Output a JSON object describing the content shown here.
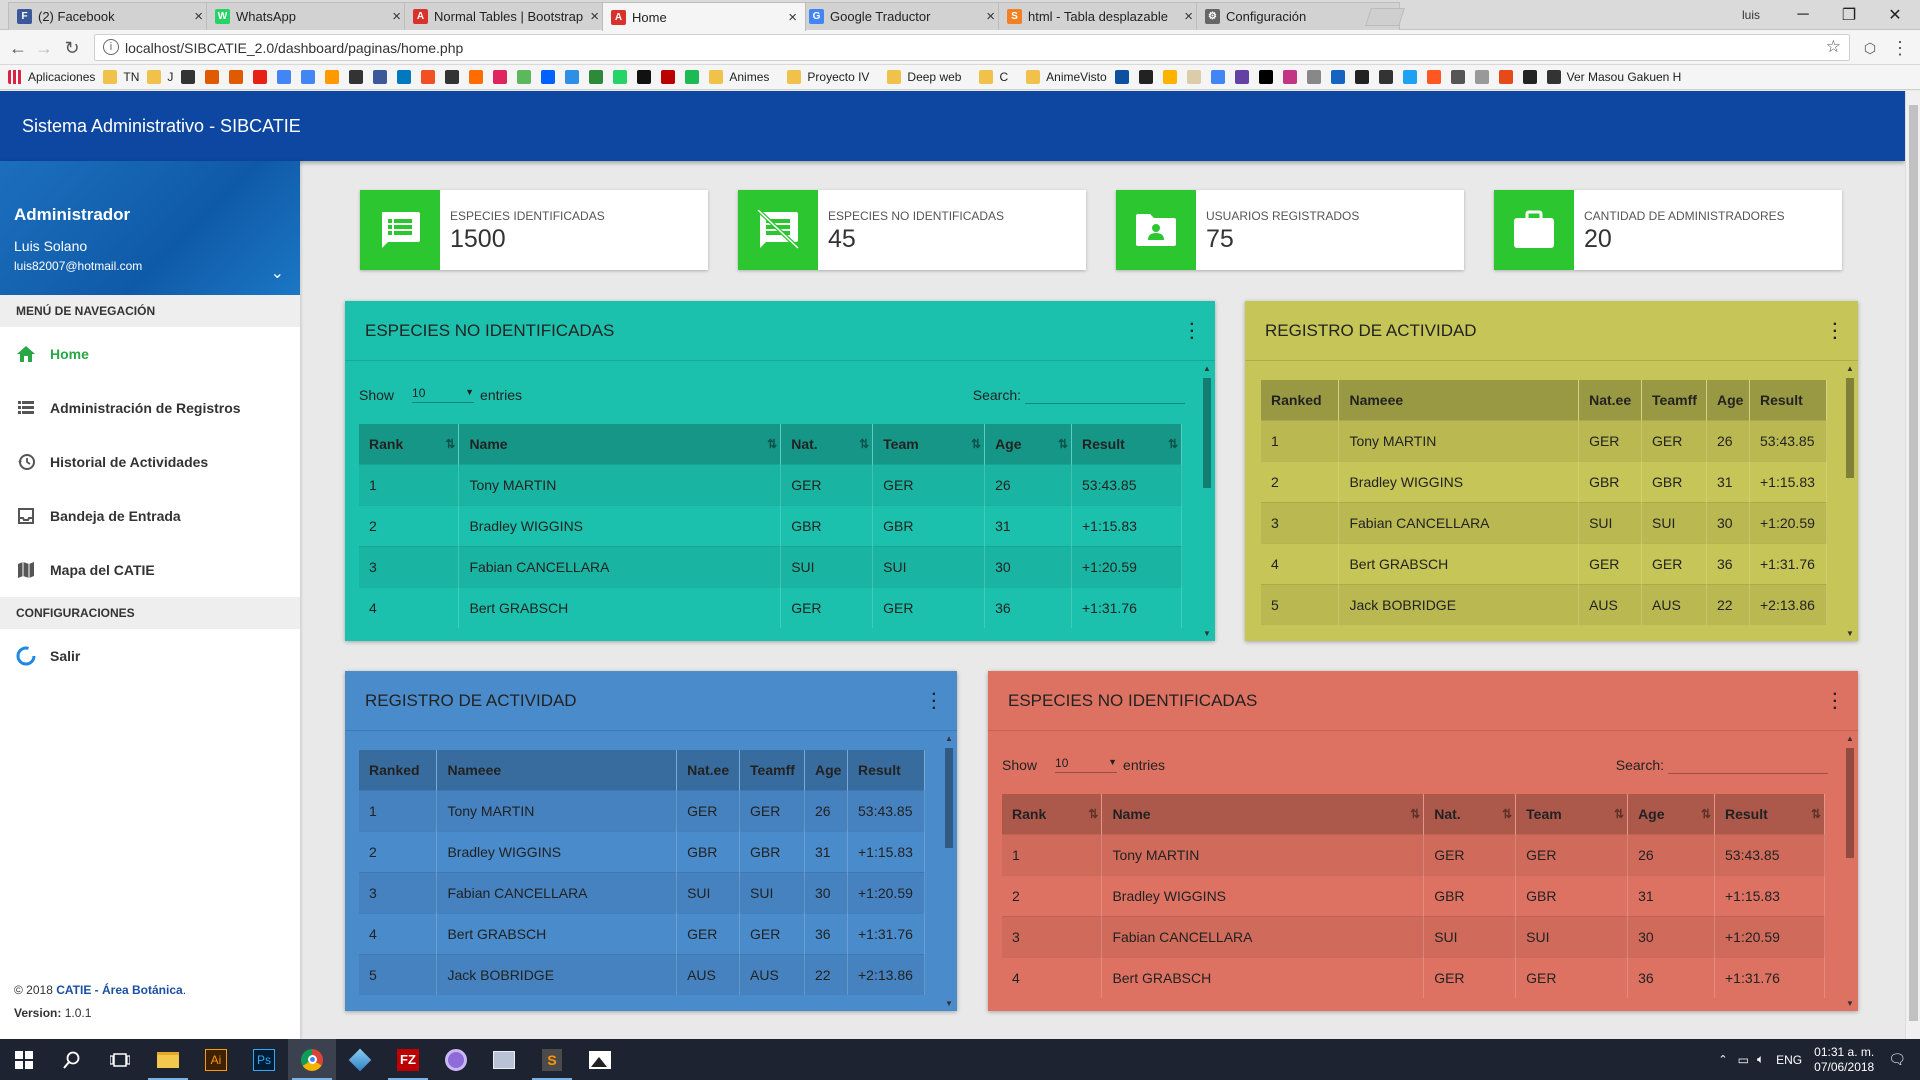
{
  "browser": {
    "tabs": [
      {
        "title": "(2) Facebook",
        "fav": "F",
        "color": "#3b5998"
      },
      {
        "title": "WhatsApp",
        "fav": "W",
        "color": "#25d366"
      },
      {
        "title": "Normal Tables | Bootstrap",
        "fav": "A",
        "color": "#d9322c"
      },
      {
        "title": "Home",
        "fav": "A",
        "color": "#d9322c"
      },
      {
        "title": "Google Traductor",
        "fav": "G",
        "color": "#4285f4"
      },
      {
        "title": "html - Tabla desplazable",
        "fav": "S",
        "color": "#f48024"
      },
      {
        "title": "Configuración",
        "fav": "⚙",
        "color": "#666666"
      }
    ],
    "profile": "luis",
    "url": "localhost/SIBCATIE_2.0/dashboard/paginas/home.php",
    "bookmarks": [
      "Aplicaciones",
      "TN",
      "J",
      "Animes",
      "Proyecto IV",
      "Deep web",
      "C",
      "AnimeVisto",
      "Ver Masou Gakuen H"
    ]
  },
  "app": {
    "title": "Sistema Administrativo - SIBCATIE",
    "user": {
      "role": "Administrador",
      "name": "Luis Solano",
      "email": "luis82007@hotmail.com"
    },
    "nav_header": "MENÚ DE NAVEGACIÓN",
    "nav": [
      {
        "label": "Home",
        "icon": "home-icon"
      },
      {
        "label": "Administración de Registros",
        "icon": "list-icon"
      },
      {
        "label": "Historial de Actividades",
        "icon": "history-icon"
      },
      {
        "label": "Bandeja de Entrada",
        "icon": "inbox-icon"
      },
      {
        "label": "Mapa del CATIE",
        "icon": "map-icon"
      }
    ],
    "config_header": "CONFIGURACIONES",
    "logout": {
      "label": "Salir",
      "icon": "spinner-icon"
    },
    "footer": {
      "copyright": "© 2018",
      "org": "CATIE - Área Botánica",
      "version_label": "Version:",
      "version": "1.0.1"
    }
  },
  "stats": [
    {
      "label": "ESPECIES IDENTIFICADAS",
      "value": "1500",
      "icon": "list-icon"
    },
    {
      "label": "ESPECIES NO IDENTIFICADAS",
      "value": "45",
      "icon": "unlisted-icon"
    },
    {
      "label": "USUARIOS REGISTRADOS",
      "value": "75",
      "icon": "user-folder-icon"
    },
    {
      "label": "CANTIDAD DE ADMINISTRADORES",
      "value": "20",
      "icon": "briefcase-icon"
    }
  ],
  "cards": {
    "teal": {
      "title": "ESPECIES NO IDENTIFICADAS",
      "show": "Show",
      "entries_value": "10",
      "entries": "entries",
      "search": "Search:",
      "headers": [
        "Rank",
        "Name",
        "Nat.",
        "Team",
        "Age",
        "Result"
      ],
      "rows": [
        [
          "1",
          "Tony MARTIN",
          "GER",
          "GER",
          "26",
          "53:43.85"
        ],
        [
          "2",
          "Bradley WIGGINS",
          "GBR",
          "GBR",
          "31",
          "+1:15.83"
        ],
        [
          "3",
          "Fabian CANCELLARA",
          "SUI",
          "SUI",
          "30",
          "+1:20.59"
        ],
        [
          "4",
          "Bert GRABSCH",
          "GER",
          "GER",
          "36",
          "+1:31.76"
        ]
      ]
    },
    "olive": {
      "title": "REGISTRO DE ACTIVIDAD",
      "headers": [
        "Ranked",
        "Nameee",
        "Nat.ee",
        "Teamff",
        "Age",
        "Result"
      ],
      "rows": [
        [
          "1",
          "Tony MARTIN",
          "GER",
          "GER",
          "26",
          "53:43.85"
        ],
        [
          "2",
          "Bradley WIGGINS",
          "GBR",
          "GBR",
          "31",
          "+1:15.83"
        ],
        [
          "3",
          "Fabian CANCELLARA",
          "SUI",
          "SUI",
          "30",
          "+1:20.59"
        ],
        [
          "4",
          "Bert GRABSCH",
          "GER",
          "GER",
          "36",
          "+1:31.76"
        ],
        [
          "5",
          "Jack BOBRIDGE",
          "AUS",
          "AUS",
          "22",
          "+2:13.86"
        ]
      ]
    },
    "blue": {
      "title": "REGISTRO DE ACTIVIDAD",
      "headers": [
        "Ranked",
        "Nameee",
        "Nat.ee",
        "Teamff",
        "Age",
        "Result"
      ],
      "rows": [
        [
          "1",
          "Tony MARTIN",
          "GER",
          "GER",
          "26",
          "53:43.85"
        ],
        [
          "2",
          "Bradley WIGGINS",
          "GBR",
          "GBR",
          "31",
          "+1:15.83"
        ],
        [
          "3",
          "Fabian CANCELLARA",
          "SUI",
          "SUI",
          "30",
          "+1:20.59"
        ],
        [
          "4",
          "Bert GRABSCH",
          "GER",
          "GER",
          "36",
          "+1:31.76"
        ],
        [
          "5",
          "Jack BOBRIDGE",
          "AUS",
          "AUS",
          "22",
          "+2:13.86"
        ]
      ]
    },
    "red": {
      "title": "ESPECIES NO IDENTIFICADAS",
      "show": "Show",
      "entries_value": "10",
      "entries": "entries",
      "search": "Search:",
      "headers": [
        "Rank",
        "Name",
        "Nat.",
        "Team",
        "Age",
        "Result"
      ],
      "rows": [
        [
          "1",
          "Tony MARTIN",
          "GER",
          "GER",
          "26",
          "53:43.85"
        ],
        [
          "2",
          "Bradley WIGGINS",
          "GBR",
          "GBR",
          "31",
          "+1:15.83"
        ],
        [
          "3",
          "Fabian CANCELLARA",
          "SUI",
          "SUI",
          "30",
          "+1:20.59"
        ],
        [
          "4",
          "Bert GRABSCH",
          "GER",
          "GER",
          "36",
          "+1:31.76"
        ]
      ]
    }
  },
  "colors": {
    "teal": "#1cc1ad",
    "olive": "#c6c557",
    "blue": "#4a8bcb",
    "red": "#dd7262",
    "appbar": "#0e47a1",
    "stat_icon": "#2cc630"
  },
  "taskbar": {
    "lang": "ENG",
    "time": "01:31 a. m.",
    "date": "07/06/2018"
  }
}
